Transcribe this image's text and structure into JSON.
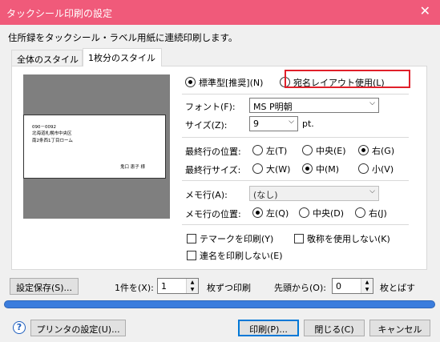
{
  "window": {
    "title": "タックシール印刷の設定",
    "close_glyph": "✕"
  },
  "description": "住所録をタックシール・ラベル用紙に連続印刷します。",
  "tabs": [
    {
      "label": "全体のスタイル",
      "active": false
    },
    {
      "label": "1枚分のスタイル",
      "active": true
    }
  ],
  "preview": {
    "lines": [
      "090－0092",
      "北海道札幌市中央区",
      "南2条西1丁目ローム",
      "鬼口 恵子 様"
    ]
  },
  "layout": {
    "standard_label": "標準型[推奨](N)",
    "standard_selected": true,
    "address_layout_label": "宛名レイアウト使用(L)",
    "address_layout_selected": false
  },
  "font": {
    "label": "フォント(F):",
    "value": "MS P明朝"
  },
  "size": {
    "label": "サイズ(Z):",
    "value": "9",
    "unit": "pt."
  },
  "last_line_position": {
    "label": "最終行の位置:",
    "options": [
      "左(T)",
      "中央(E)",
      "右(G)"
    ],
    "selected": 2
  },
  "last_line_size": {
    "label": "最終行サイズ:",
    "options": [
      "大(W)",
      "中(M)",
      "小(V)"
    ],
    "selected": 1
  },
  "memo_line": {
    "label": "メモ行(A):",
    "value": "(なし)"
  },
  "memo_position": {
    "label": "メモ行の位置:",
    "options": [
      "左(Q)",
      "中央(D)",
      "右(J)"
    ],
    "selected": 0
  },
  "checkboxes": {
    "tmark": {
      "label": "テマークを印刷(Y)",
      "checked": false
    },
    "no_honorific": {
      "label": "敬称を使用しない(K)",
      "checked": false
    },
    "no_joint_names": {
      "label": "連名を印刷しない(E)",
      "checked": false
    }
  },
  "bottom": {
    "save_settings": "設定保存(S)...",
    "per_item_label": "1件を(X):",
    "per_item_value": "1",
    "per_item_suffix": "枚ずつ印刷",
    "skip_label": "先頭から(O):",
    "skip_value": "0",
    "skip_suffix": "枚とばす",
    "progress_percent": 100
  },
  "footer": {
    "help": "?",
    "printer_settings": "プリンタの設定(U)...",
    "print": "印刷(P)...",
    "close": "閉じる(C)",
    "cancel": "キャンセル"
  },
  "colors": {
    "titlebar": "#f05a7a",
    "highlight": "#e0202a",
    "progress": "#3b7ddd"
  }
}
